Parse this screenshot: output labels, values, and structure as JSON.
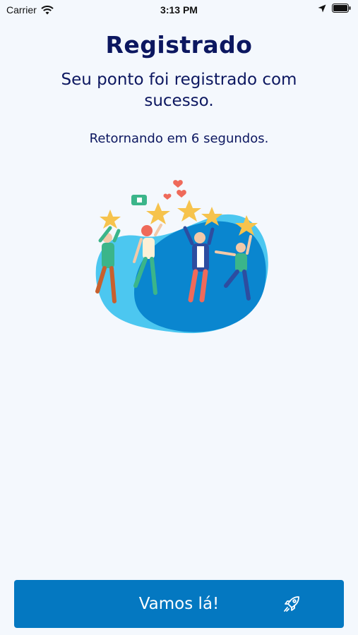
{
  "status_bar": {
    "carrier": "Carrier",
    "time": "3:13 PM"
  },
  "screen": {
    "title": "Registrado",
    "message": "Seu ponto foi registrado com sucesso.",
    "countdown": "Retornando em 6 segundos."
  },
  "action_button": {
    "label": "Vamos lá!",
    "icon": "rocket-icon"
  },
  "colors": {
    "accent": "#0478c1",
    "text": "#0c1760",
    "background": "#f4f8fd"
  }
}
